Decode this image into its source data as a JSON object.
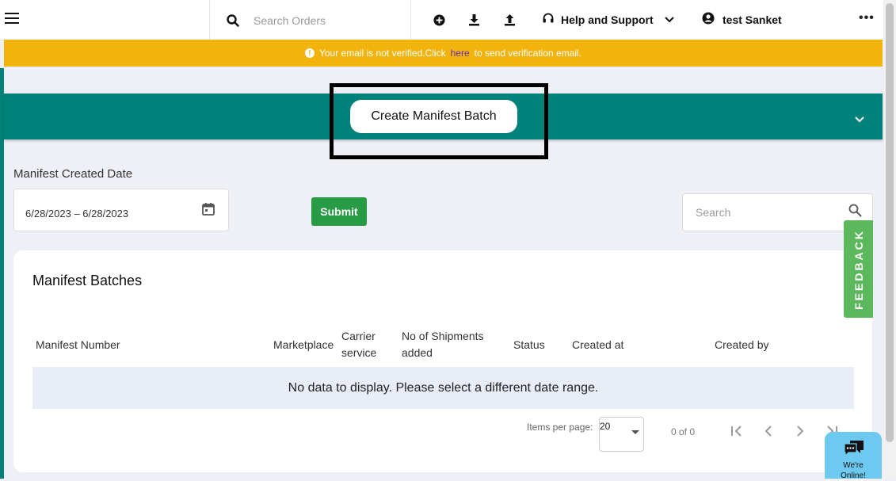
{
  "topbar": {
    "search_placeholder": "Search Orders",
    "help_label": "Help and Support",
    "user_label": "test Sanket",
    "icons": [
      "menu-icon",
      "search-icon",
      "add-circle-icon",
      "download-icon",
      "upload-icon",
      "headset-icon",
      "chevron-down-icon",
      "user-icon",
      "more-icon"
    ]
  },
  "banner": {
    "text_before": "Your email is not verified.Click",
    "link_text": "here",
    "text_after": "to send verification email."
  },
  "header": {
    "create_button": "Create Manifest Batch"
  },
  "filter": {
    "date_label": "Manifest Created Date",
    "date_range": "6/28/2023 – 6/28/2023",
    "submit_label": "Submit",
    "search_placeholder": "Search"
  },
  "table": {
    "title": "Manifest Batches",
    "columns": [
      "Manifest Number",
      "Marketplace",
      "Carrier service",
      "No of Shipments added",
      "Status",
      "Created at",
      "Created by"
    ],
    "empty_message": "No data to display. Please select a different date range.",
    "items_per_page_label": "Items per page:",
    "items_per_page_value": "20",
    "range_label": "0 of 0"
  },
  "feedback": {
    "label": "FEEDBACK"
  },
  "chat": {
    "line1": "We're",
    "line2": "Online!"
  },
  "colors": {
    "teal": "#00827a",
    "banner": "#f2b40c",
    "submit": "#289c45",
    "feedback": "#5cb85c",
    "chat": "#6ec9f0"
  }
}
